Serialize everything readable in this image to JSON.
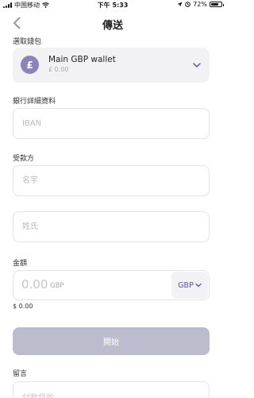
{
  "status_bar": {
    "carrier": "中国移动",
    "time": "下午 5:33",
    "battery_text": "72%",
    "battery_level": 0.72
  },
  "nav": {
    "title": "傳送"
  },
  "wallet": {
    "section_label": "選取錢包",
    "currency_symbol": "£",
    "name": "Main GBP wallet",
    "balance": "£ 0.00"
  },
  "bank": {
    "section_label": "銀行詳細資料",
    "iban_placeholder": "IBAN"
  },
  "recipient": {
    "section_label": "受款方",
    "first_name_placeholder": "名字",
    "last_name_placeholder": "姓氏"
  },
  "amount": {
    "section_label": "金額",
    "value": "0.00",
    "currency_code": "GBP",
    "currency_selector": "GBP",
    "fee": "$ 0.00"
  },
  "start_button": "開始",
  "note": {
    "section_label": "留言",
    "placeholder": "付款目的"
  },
  "colors": {
    "accent": "#5b51b8",
    "badge": "#8a84b8",
    "button_disabled": "#bcbccf"
  }
}
